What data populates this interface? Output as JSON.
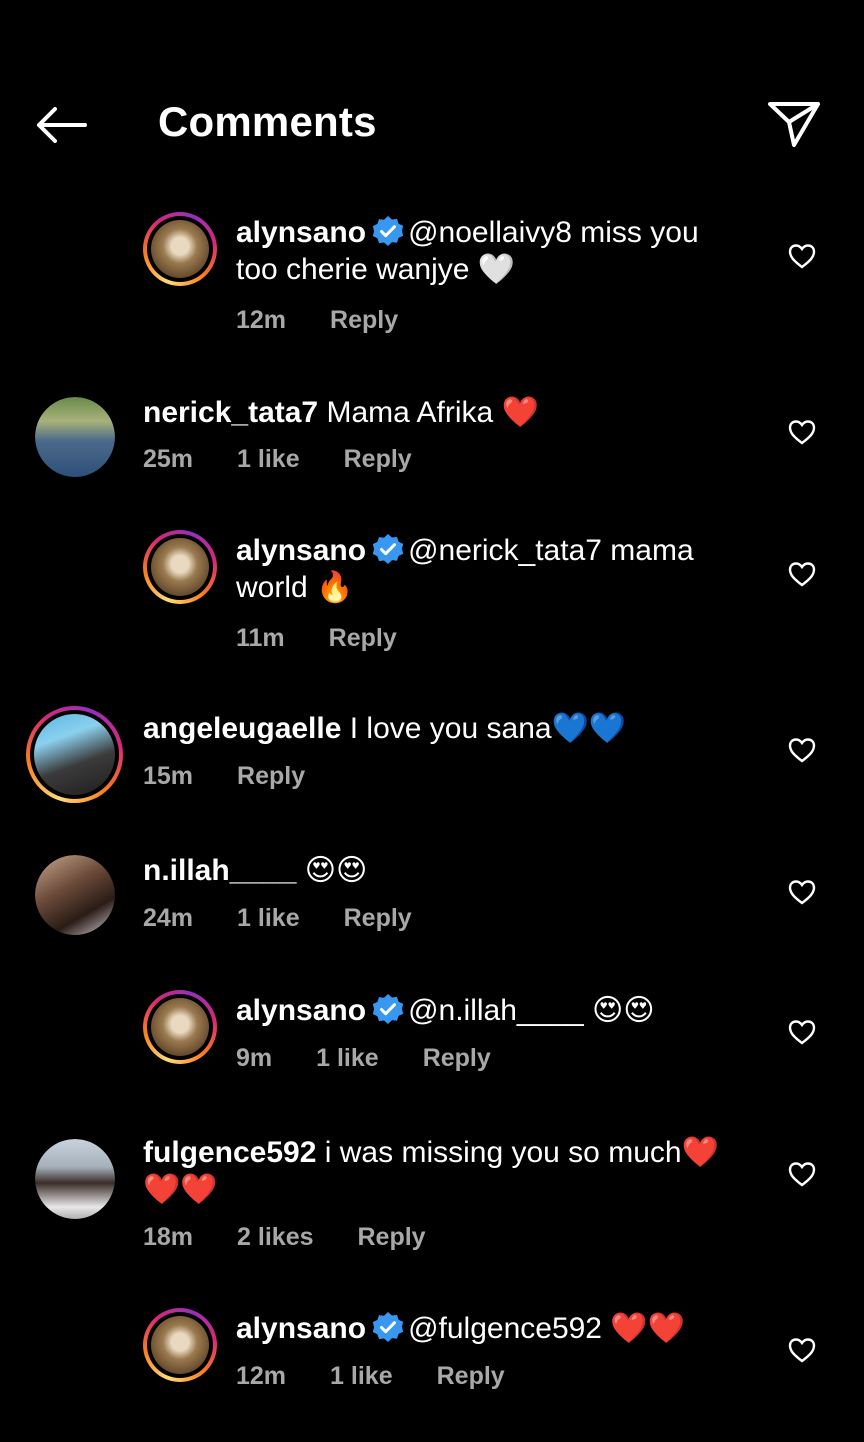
{
  "header": {
    "title": "Comments",
    "back_icon": "arrow-left-icon",
    "share_icon": "send-icon"
  },
  "colors": {
    "background": "#000000",
    "meta": "#a8a8a8",
    "verified": "#3897f0",
    "heart": "#ed4956",
    "blue_heart": "#2e8bff"
  },
  "comments": [
    {
      "user": "alynsano",
      "verified": true,
      "reply": true,
      "text": "@noellaivy8 miss you",
      "text2": "too cherie wanjye 🤍",
      "time": "12m",
      "likes": "",
      "reply_label": "Reply"
    },
    {
      "user": "nerick_tata7",
      "verified": false,
      "reply": false,
      "text": "Mama Afrika ❤️",
      "time": "25m",
      "likes": "1 like",
      "reply_label": "Reply"
    },
    {
      "user": "alynsano",
      "verified": true,
      "reply": true,
      "text": "@nerick_tata7 mama",
      "text2": "world 🔥",
      "time": "11m",
      "likes": "",
      "reply_label": "Reply"
    },
    {
      "user": "angeleugaelle",
      "verified": false,
      "reply": false,
      "text": "I love you sana💙💙",
      "time": "15m",
      "likes": "",
      "reply_label": "Reply"
    },
    {
      "user": "n.illah____",
      "verified": false,
      "reply": false,
      "text": "😍😍",
      "time": "24m",
      "likes": "1 like",
      "reply_label": "Reply"
    },
    {
      "user": "alynsano",
      "verified": true,
      "reply": true,
      "text": "@n.illah____ 😍😍",
      "time": "9m",
      "likes": "1 like",
      "reply_label": "Reply"
    },
    {
      "user": "fulgence592",
      "verified": false,
      "reply": false,
      "text": "i was missing you so much❤️",
      "text2": "❤️❤️",
      "time": "18m",
      "likes": "2 likes",
      "reply_label": "Reply"
    },
    {
      "user": "alynsano",
      "verified": true,
      "reply": true,
      "text": "@fulgence592 ❤️❤️",
      "time": "12m",
      "likes": "1 like",
      "reply_label": "Reply"
    }
  ]
}
